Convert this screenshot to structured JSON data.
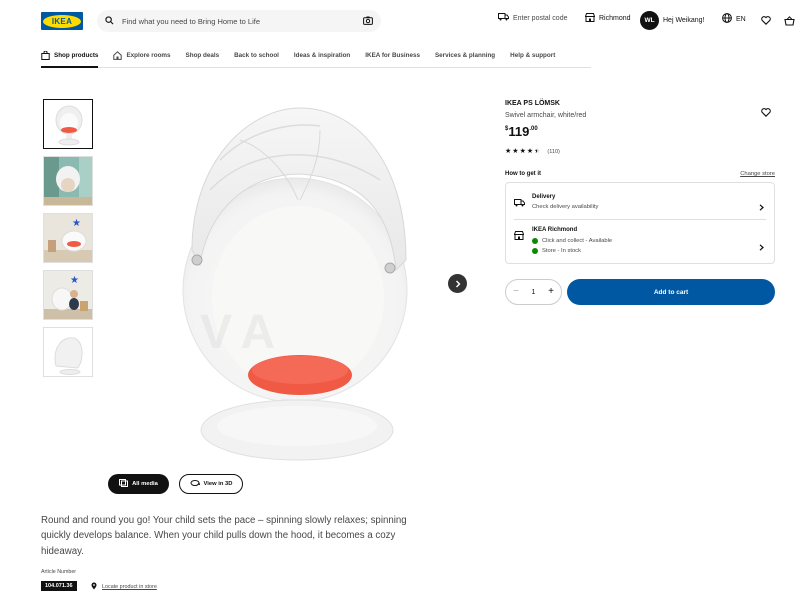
{
  "header": {
    "logo_text": "IKEA",
    "search_placeholder": "Find what you need to Bring Home to Life",
    "postal": "Enter postal code",
    "store": "Richmond",
    "avatar_initials": "WL",
    "greeting": "Hej Weikang!",
    "language": "EN"
  },
  "nav": {
    "items": [
      {
        "label": "Shop products"
      },
      {
        "label": "Explore rooms"
      },
      {
        "label": "Shop deals"
      },
      {
        "label": "Back to school"
      },
      {
        "label": "Ideas & inspiration"
      },
      {
        "label": "IKEA for Business"
      },
      {
        "label": "Services & planning"
      },
      {
        "label": "Help & support"
      }
    ]
  },
  "gallery": {
    "all_media_label": "All media",
    "view_3d_label": "View in 3D"
  },
  "product": {
    "name": "IKEA PS LÖMSK",
    "subtitle": "Swivel armchair, white/red",
    "currency": "$",
    "price_int": "119",
    "price_dec": ".00",
    "rating": 4.5,
    "review_count": "(110)",
    "description": "Round and round you go! Your child sets the pace – spinning slowly relaxes; spinning quickly develops balance. When your child pulls down the hood, it becomes a cozy hideaway.",
    "article_label": "Article Number",
    "article_number": "104.071.36",
    "locate_label": "Locate product in store"
  },
  "availability": {
    "heading": "How to get it",
    "change_store": "Change store",
    "delivery_title": "Delivery",
    "delivery_sub": "Check delivery availability",
    "store_title": "IKEA Richmond",
    "click_collect": "Click and collect - Available",
    "store_stock": "Store - In stock"
  },
  "purchase": {
    "quantity": "1",
    "minus": "−",
    "plus": "+",
    "add_to_cart": "Add to cart"
  },
  "watermark": "VA",
  "colors": {
    "brand_blue": "#0058a3",
    "brand_yellow": "#ffdb00",
    "stock_green": "#0a8a00",
    "cushion_red": "#f05a45"
  }
}
